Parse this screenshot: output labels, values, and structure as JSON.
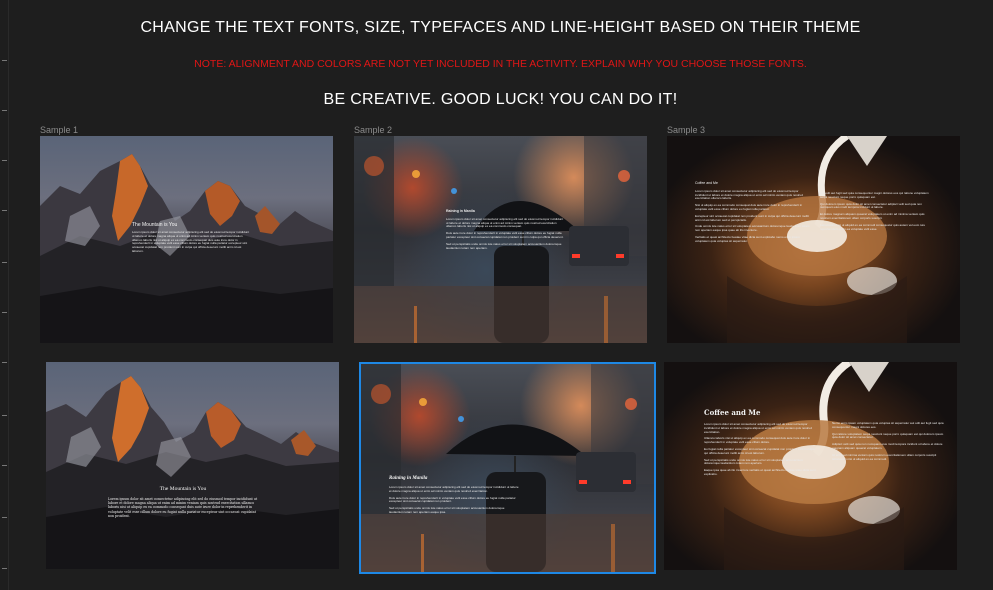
{
  "header": {
    "instruction": "CHANGE THE TEXT FONTS, SIZE, TYPEFACES AND LINE-HEIGHT BASED ON THEIR THEME",
    "note": "NOTE: ALIGNMENT AND COLORS ARE NOT YET INCLUDED IN THE ACTIVITY. EXPLAIN WHY YOU CHOOSE THOSE FONTS.",
    "motto": "BE CREATIVE. GOOD LUCK! YOU CAN DO IT!"
  },
  "samples": [
    {
      "label": "Sample 1"
    },
    {
      "label": "Sample 2"
    },
    {
      "label": "Sample 3"
    }
  ],
  "cards": {
    "mountain_top": {
      "title": "The Mountain is You",
      "body": "Lorem ipsum dolor sit amet consectetur adipiscing elit sed do eiusmod tempor incididunt ut labore et dolore magna aliqua ut enim ad minim veniam quis nostrud exercitation ullamco laboris nisi ut aliquip ex ea commodo consequat duis aute irure dolor in reprehenderit in voluptate velit esse cillum dolore eu fugiat nulla pariatur excepteur sint occaecat cupidatat non proident sunt in culpa qui officia deserunt mollit anim id est laborum."
    },
    "rain_top": {
      "title": "Raining in Manila",
      "paragraphs": [
        "Lorem ipsum dolor sit amet consectetur adipiscing elit sed do eiusmod tempor incididunt ut labore et dolore magna aliqua ut enim ad minim veniam quis nostrud exercitation ullamco laboris nisi ut aliquip ex ea commodo consequat.",
        "Duis aute irure dolor in reprehenderit in voluptate velit esse cillum dolore eu fugiat nulla pariatur excepteur sint occaecat cupidatat non proident sunt in culpa qui officia deserunt.",
        "Sed ut perspiciatis unde omnis iste natus error sit voluptatem accusantium doloremque laudantium totam rem aperiam."
      ]
    },
    "coffee_top": {
      "title": "Coffee and Me",
      "col1": [
        "Lorem ipsum dolor sit amet consectetur adipiscing elit sed do eiusmod tempor incididunt ut labore et dolore magna aliqua ut enim ad minim veniam quis nostrud exercitation ullamco laboris.",
        "Nisi ut aliquip ex ea commodo consequat duis aute irure dolor in reprehenderit in voluptate velit esse cillum dolore eu fugiat nulla pariatur.",
        "Excepteur sint occaecat cupidatat non proident sunt in culpa qui officia deserunt mollit anim id est laborum sed ut perspiciatis.",
        "Unde omnis iste natus error sit voluptatem accusantium doloremque laudantium totam rem aperiam eaque ipsa quae ab illo inventore.",
        "Veritatis et quasi architecto beatae vitae dicta sunt explicabo nemo enim ipsam voluptatem quia voluptas sit aspernatur."
      ],
      "col2": [
        "Aut odit aut fugit sed quia consequuntur magni dolores eos qui ratione voluptatem sequi nesciunt neque porro quisquam est.",
        "Qui dolorem ipsum quia dolor sit amet consectetur adipisci velit sed quia non numquam eius modi tempora incidunt ut labore.",
        "Et dolore magnam aliquam quaerat voluptatem ut enim ad minima veniam quis nostrum exercitationem ullam corporis suscipit.",
        "Laboriosam nisi ut aliquid ex ea commodi consequatur quis autem vel eum iure reprehenderit qui in ea voluptate velit esse."
      ]
    },
    "mountain_bottom": {
      "title": "The Mountain is You",
      "body": "Lorem ipsum dolor sit amet consectetur adipiscing elit sed do eiusmod tempor incididunt ut labore et dolore magna aliqua ut enim ad minim veniam quis nostrud exercitation ullamco laboris nisi ut aliquip ex ea commodo consequat duis aute irure dolor in reprehenderit in voluptate velit esse cillum dolore eu fugiat nulla pariatur excepteur sint occaecat cupidatat non proident."
    },
    "rain_bottom": {
      "title": "Raining in Manila",
      "paragraphs": [
        "Lorem ipsum dolor sit amet consectetur adipiscing elit sed do eiusmod tempor incididunt ut labore et dolore magna aliqua ut enim ad minim veniam quis nostrud exercitation.",
        "Duis aute irure dolor in reprehenderit in voluptate velit esse cillum dolore eu fugiat nulla pariatur excepteur sint occaecat cupidatat non proident.",
        "Sed ut perspiciatis unde omnis iste natus error sit voluptatem accusantium doloremque laudantium totam rem aperiam eaque ipsa."
      ]
    },
    "coffee_bottom": {
      "title": "Coffee and Me",
      "col1": [
        "Lorem ipsum dolor sit amet consectetur adipiscing elit sed do eiusmod tempor incididunt ut labore et dolore magna aliqua ut enim ad minim veniam quis nostrud exercitation.",
        "Ullamco laboris nisi ut aliquip ex ea commodo consequat duis aute irure dolor in reprehenderit in voluptate velit esse cillum dolore.",
        "Eu fugiat nulla pariatur excepteur sint occaecat cupidatat non proident sunt in culpa qui officia deserunt mollit anim id est laborum.",
        "Sed ut perspiciatis unde omnis iste natus error sit voluptatem accusantium doloremque laudantium totam rem aperiam.",
        "Eaque ipsa quae ab illo inventore veritatis et quasi architecto beatae vitae dicta sunt explicabo."
      ],
      "col2": [
        "Nemo enim ipsam voluptatem quia voluptas sit aspernatur aut odit aut fugit sed quia consequuntur magni dolores eos.",
        "Qui ratione voluptatem sequi nesciunt neque porro quisquam est qui dolorem ipsum quia dolor sit amet consectetur.",
        "Adipisci velit sed quia non numquam eius modi tempora incidunt ut labore et dolore magnam aliquam quaerat voluptatem.",
        "Ut enim ad minima veniam quis nostrum exercitationem ullam corporis suscipit laboriosam nisi ut aliquid ex ea commodi."
      ]
    }
  },
  "colors": {
    "canvas": "#1e1e1e",
    "note_red": "#e01616",
    "selection_blue": "#1e88e5"
  }
}
